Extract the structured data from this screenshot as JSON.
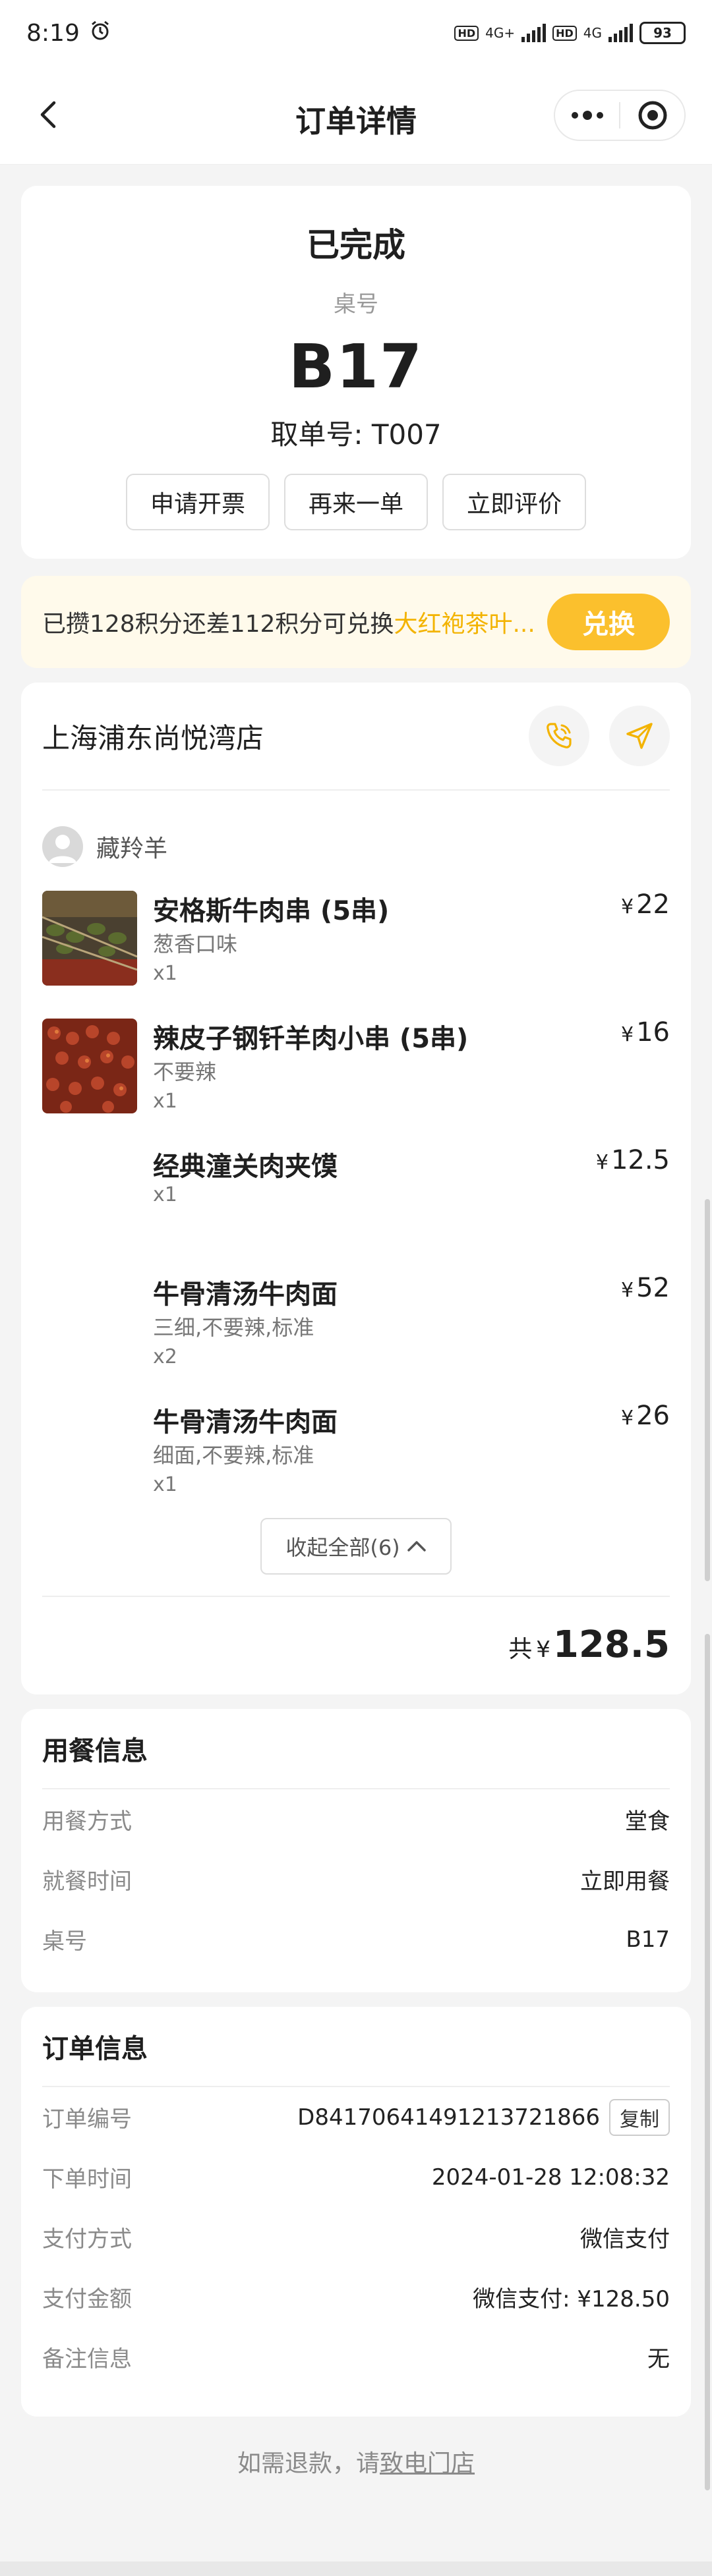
{
  "status_bar": {
    "time": "8:19",
    "network1": "4G+",
    "network2": "4G",
    "battery": "93",
    "hd": "HD"
  },
  "nav": {
    "title": "订单详情"
  },
  "order_status": {
    "status": "已完成",
    "table_label": "桌号",
    "table_no": "B17",
    "pickup": "取单号: T007",
    "actions": [
      "申请开票",
      "再来一单",
      "立即评价"
    ]
  },
  "points": {
    "text_prefix": "已攒128积分还差112积分可兑换",
    "text_highlight": "大红袍茶叶...",
    "button": "兑换"
  },
  "store": {
    "name": "上海浦东尚悦湾店"
  },
  "user": {
    "name": "藏羚羊"
  },
  "items": [
    {
      "name": "安格斯牛肉串 (5串)",
      "spec": "葱香口味",
      "qty": "x1",
      "currency": "¥",
      "price": "22",
      "has_image": true
    },
    {
      "name": "辣皮子钢钎羊肉小串 (5串)",
      "spec": "不要辣",
      "qty": "x1",
      "currency": "¥",
      "price": "16",
      "has_image": true
    },
    {
      "name": "经典潼关肉夹馍",
      "spec": "",
      "qty": "x1",
      "currency": "¥",
      "price": "12.5",
      "has_image": false
    },
    {
      "name": "牛骨清汤牛肉面",
      "spec": "三细,不要辣,标准",
      "qty": "x2",
      "currency": "¥",
      "price": "52",
      "has_image": false
    },
    {
      "name": "牛骨清汤牛肉面",
      "spec": "细面,不要辣,标准",
      "qty": "x1",
      "currency": "¥",
      "price": "26",
      "has_image": false
    }
  ],
  "collapse": {
    "label": "收起全部(6)"
  },
  "total": {
    "label": "共",
    "currency": "¥",
    "value": "128.5"
  },
  "dining_info": {
    "title": "用餐信息",
    "rows": [
      {
        "label": "用餐方式",
        "value": "堂食"
      },
      {
        "label": "就餐时间",
        "value": "立即用餐"
      },
      {
        "label": "桌号",
        "value": "B17"
      }
    ]
  },
  "order_info": {
    "title": "订单信息",
    "copy_label": "复制",
    "rows": [
      {
        "label": "订单编号",
        "value": "D84170641491213721866"
      },
      {
        "label": "下单时间",
        "value": "2024-01-28 12:08:32"
      },
      {
        "label": "支付方式",
        "value": "微信支付"
      },
      {
        "label": "支付金额",
        "value": "微信支付: ¥128.50"
      },
      {
        "label": "备注信息",
        "value": "无"
      }
    ]
  },
  "footer": {
    "text": "如需退款，请",
    "link": "致电门店"
  },
  "colors": {
    "accent": "#fbc02d",
    "highlight": "#f3b300",
    "points_bg": "#fffaeb",
    "page_bg": "#f4f4f4"
  }
}
